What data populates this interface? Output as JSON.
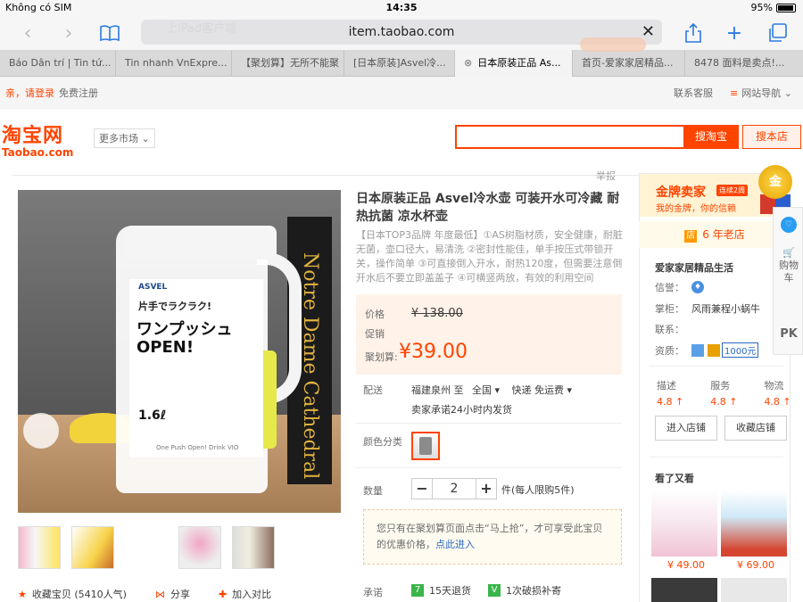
{
  "status_bar": {
    "carrier": "Không có SIM",
    "time": "14:35",
    "battery": "95%"
  },
  "browser": {
    "url": "item.taobao.com",
    "ghost_text": "上iPad客户端",
    "tabs": [
      {
        "label": "Báo Dân trí | Tin tứ..."
      },
      {
        "label": "Tin nhanh VnExpre..."
      },
      {
        "label": "【聚划算】无所不能聚"
      },
      {
        "label": "[日本原装]Asvel冷..."
      },
      {
        "label": "日本原装正品 As...",
        "active": true
      },
      {
        "label": "首页-爱家家居精品..."
      },
      {
        "label": "8478 面料是卖点!..."
      }
    ]
  },
  "site_bar": {
    "login": "亲，请登录",
    "register": "免费注册",
    "service": "联系客服",
    "nav": "网站导航"
  },
  "header": {
    "logo_cn": "淘宝网",
    "logo_en": "Taobao.com",
    "market": "更多市场",
    "search_button": "搜淘宝",
    "store_button": "搜本店",
    "report": "举报"
  },
  "product": {
    "title": "日本原装正品 Asvel冷水壶 可装开水可冷藏 耐热抗菌 凉水杯壶",
    "description": "【日本TOP3品牌 年度最低】①AS树脂材质，安全健康，耐脏无菌，壶口径大，易清洗 ②密封性能佳，单手按压式带锁开关，操作简单 ③可直接倒入开水，耐热120度，但需要注意倒开水后不要立即盖盖子 ④可横竖两放，有效的利用空间",
    "image_texts": {
      "brand": "ASVEL",
      "line1": "片手でラクラク!",
      "line2": "ワンプッシュ",
      "line3": "OPEN!",
      "volume": "1.6ℓ",
      "footer": "One Push Open! Drink VIO",
      "book": "Notre Dame Cathedral"
    },
    "price_label": "价格",
    "price_old": "¥ 138.00",
    "promo_label": "促销",
    "juhuasuan_label": "聚划算:",
    "price_new": "¥39.00",
    "delivery_label": "配送",
    "delivery_from": "福建泉州 至",
    "delivery_to": "全国",
    "delivery_method": "快递 免运费",
    "delivery_note": "卖家承诺24小时内发货",
    "color_label": "颜色分类",
    "quantity_label": "数量",
    "quantity": "2",
    "quantity_note": "件(每人限购5件)",
    "notice_text": "您只有在聚划算页面点击“马上抢”，才可享受此宝贝的优惠价格，",
    "notice_link": "点此进入",
    "promise_label": "承诺",
    "promise_1": "15天退货",
    "promise_2": "1次破损补寄",
    "actions": [
      {
        "label": "收藏宝贝 (5410人气)"
      },
      {
        "label": "分享"
      },
      {
        "label": "加入对比"
      }
    ]
  },
  "seller": {
    "gold_title": "金牌卖家",
    "gold_badge": "连续2周",
    "gold_sub": "我的金牌，你的信赖",
    "medal": "金",
    "years": "6 年老店",
    "years_icon": "店",
    "shop_name": "爱家家居精品生活",
    "credit_label": "信誉：",
    "owner_label": "掌柜：",
    "owner": "风雨兼程小蜗牛",
    "contact_label": "联系：",
    "qualification_label": "资质：",
    "qualification_amount": "1000元",
    "scores": [
      {
        "name": "描述",
        "value": "4.8 ↑"
      },
      {
        "name": "服务",
        "value": "4.8 ↑"
      },
      {
        "name": "物流",
        "value": "4.8 ↑"
      }
    ],
    "enter_shop": "进入店铺",
    "favorite_shop": "收藏店铺",
    "see_also": "看了又看",
    "recommendations": [
      {
        "price": "¥ 49.00"
      },
      {
        "price": "¥ 69.00"
      }
    ]
  },
  "side_tools": {
    "cart": "购物车",
    "pk": "PK"
  }
}
